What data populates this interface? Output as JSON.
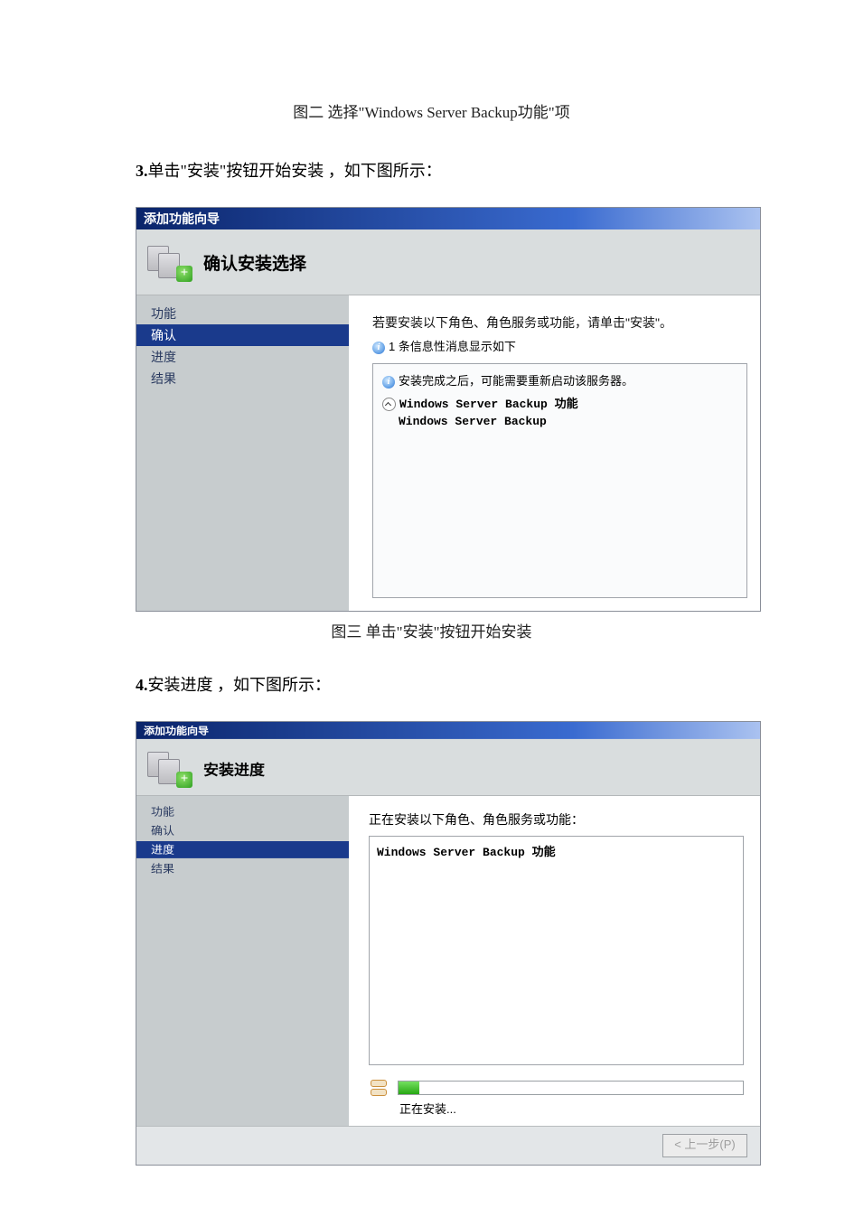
{
  "captions": {
    "fig2": "图二 选择\"Windows Server Backup功能\"项",
    "fig3": "图三 单击\"安装\"按钮开始安装"
  },
  "steps": {
    "s3_num": "3.",
    "s3_text": "单击\"安装\"按钮开始安装 ，如下图所示：",
    "s4_num": "4.",
    "s4_text": "安装进度 ，如下图所示："
  },
  "wizard1": {
    "title": "添加功能向导",
    "header": "确认安装选择",
    "nav": [
      "功能",
      "确认",
      "进度",
      "结果"
    ],
    "active_index": 1,
    "top_line": "若要安装以下角色、角色服务或功能，请单击\"安装\"。",
    "info_line": "1 条信息性消息显示如下",
    "box_line1": "安装完成之后，可能需要重新启动该服务器。",
    "feature": "Windows Server Backup 功能",
    "feature_sub": "Windows Server Backup"
  },
  "wizard2": {
    "title": "添加功能向导",
    "header": "安装进度",
    "nav": [
      "功能",
      "确认",
      "进度",
      "结果"
    ],
    "active_index": 2,
    "top_line": "正在安装以下角色、角色服务或功能：",
    "feature": "Windows Server Backup 功能",
    "progress_text": "正在安装...",
    "back_button": "< 上一步(P)"
  }
}
